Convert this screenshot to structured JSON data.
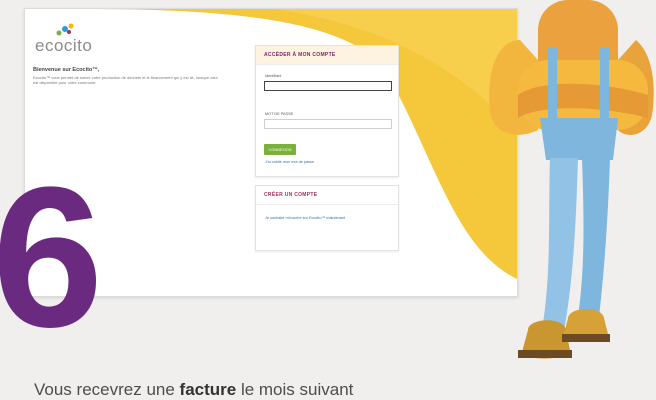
{
  "app": {
    "logo_text": "ecocito"
  },
  "welcome": {
    "title": "Bienvenue sur Ecocito™,",
    "body": "Ecocito™ vous permet de suivre votre production de déchets et le financement qui y est lié, lorsque cela est disponible pour votre commune."
  },
  "login_panel": {
    "title": "ACCÉDER À MON COMPTE",
    "username_label": "Identifiant",
    "username_value": "",
    "password_label": "MOT DE PASSE",
    "password_value": "",
    "submit_label": "CONNEXION",
    "forgot_link": "J'ai oublié mon mot de passe"
  },
  "create_panel": {
    "title": "CRÉER UN COMPTE",
    "link": "Je souhaite m'inscrire sur Ecocito™ maintenant"
  },
  "overlay": {
    "step_number": "6",
    "caption_before": "Vous recevrez une ",
    "caption_bold": "facture",
    "caption_after": " le mois suivant"
  },
  "colors": {
    "brand_yellow": "#f5c73b",
    "brand_purple": "#6a2a80",
    "button_green": "#7ab13b",
    "link_blue": "#2f6fb0"
  }
}
